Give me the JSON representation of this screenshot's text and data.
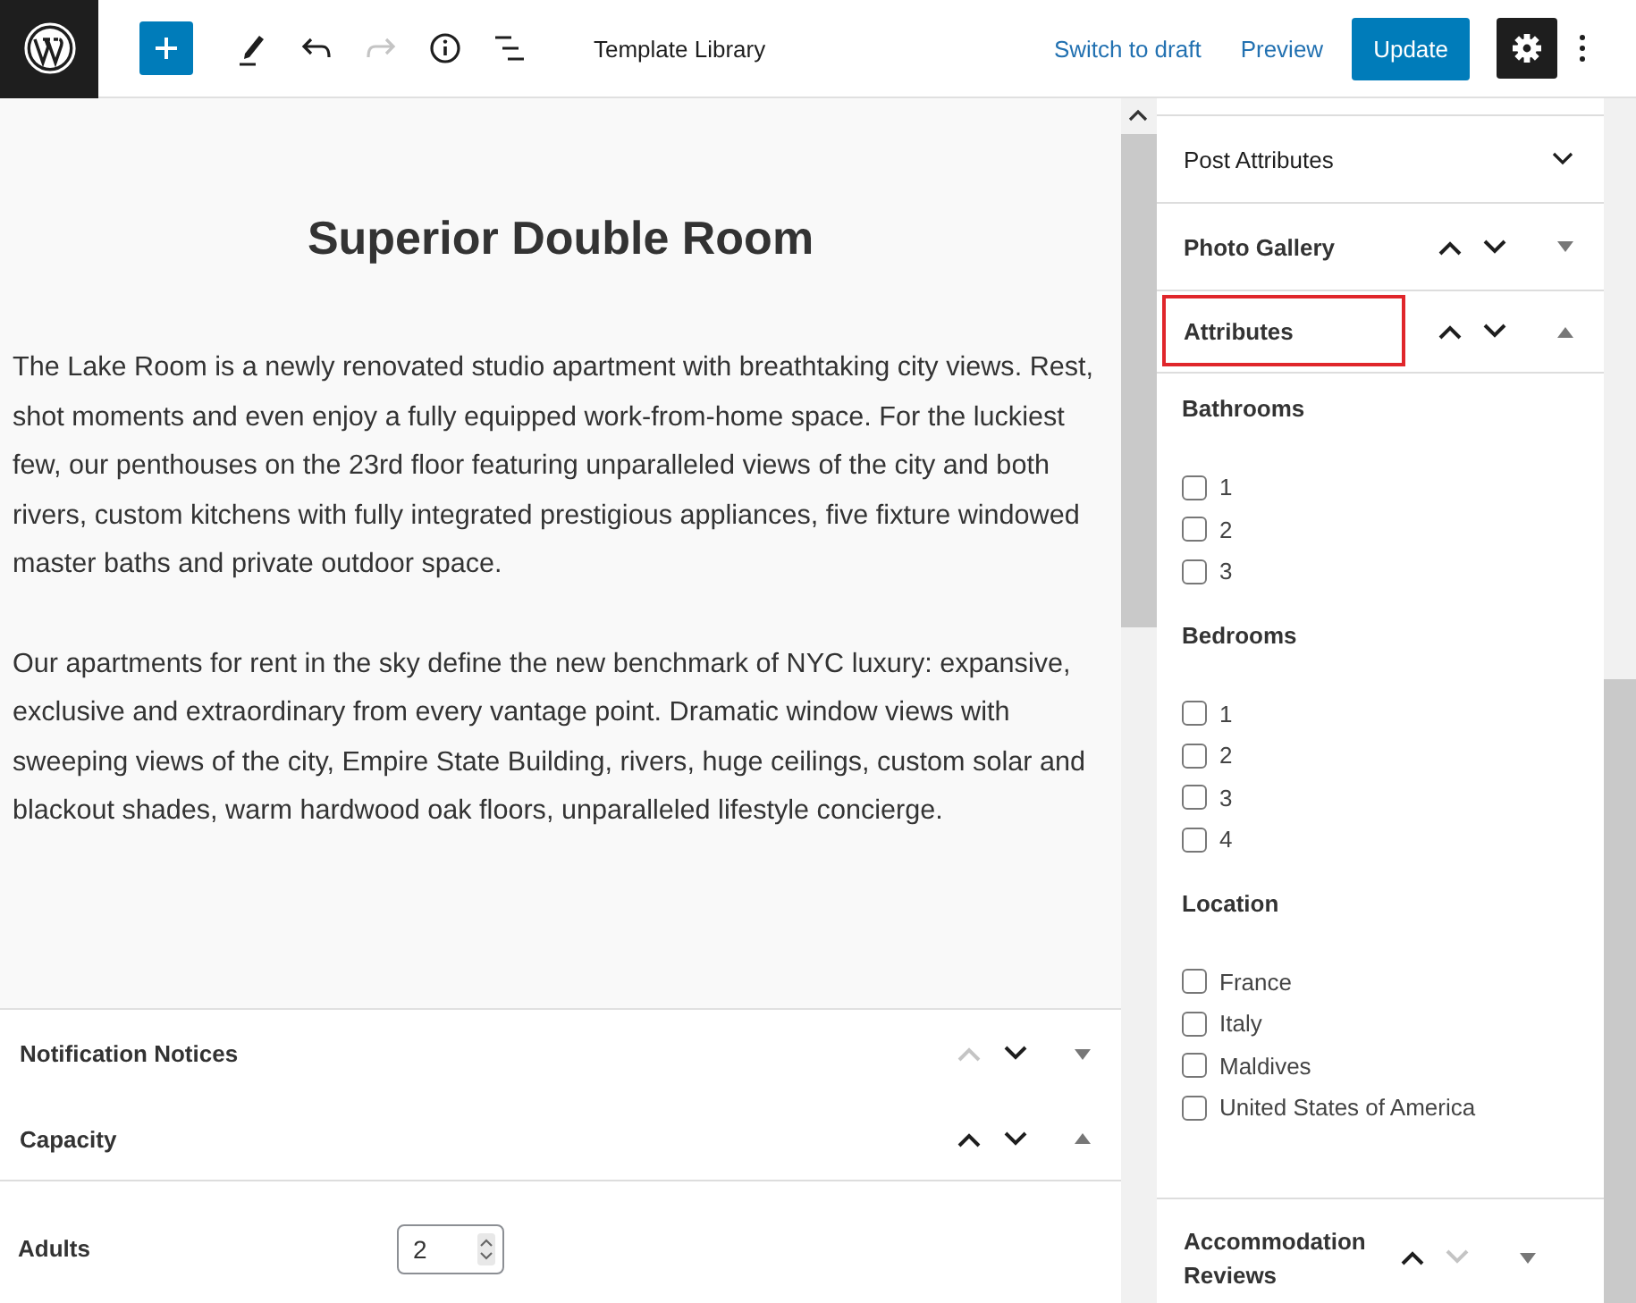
{
  "toolbar": {
    "title": "Template Library",
    "redo_disabled": true,
    "links": [
      "Switch to draft",
      "Preview"
    ],
    "primary_button": "Update",
    "settings_active": true
  },
  "post": {
    "title": "Superior Double Room",
    "paragraphs": [
      "The Lake Room is a newly renovated studio apartment with breathtaking city views. Rest, shot moments and even enjoy a fully equipped work-from-home space. For the luckiest few, our penthouses on the 23rd floor featuring unparalleled views of the city and both rivers, custom kitchens with fully integrated prestigious appliances, five fixture windowed master baths and private outdoor space.",
      "Our apartments for rent in the sky define the new benchmark of NYC luxury: expansive, exclusive and extraordinary from every vantage point. Dramatic window views with sweeping views of the city, Empire State Building, rivers, huge ceilings, custom solar and blackout shades, warm hardwood oak floors, unparalleled lifestyle concierge."
    ]
  },
  "meta_boxes": [
    {
      "title": "Notification Notices",
      "can_move_up": false,
      "can_move_down": true,
      "expanded": false
    },
    {
      "title": "Capacity",
      "can_move_up": true,
      "can_move_down": true,
      "expanded": true,
      "fields": [
        {
          "label": "Adults",
          "value": "2"
        }
      ]
    }
  ],
  "sidebar": {
    "panels": [
      {
        "kind": "simple",
        "title": "Post Attributes",
        "expanded": false
      },
      {
        "kind": "movable",
        "title": "Photo Gallery",
        "can_move_up": true,
        "can_move_down": true,
        "expanded": false,
        "highlighted": false
      },
      {
        "kind": "movable",
        "title": "Attributes",
        "can_move_up": true,
        "can_move_down": true,
        "expanded": true,
        "highlighted": true,
        "groups": [
          {
            "title": "Bathrooms",
            "options": [
              {
                "label": "1",
                "checked": false
              },
              {
                "label": "2",
                "checked": false
              },
              {
                "label": "3",
                "checked": false
              }
            ]
          },
          {
            "title": "Bedrooms",
            "options": [
              {
                "label": "1",
                "checked": false
              },
              {
                "label": "2",
                "checked": false
              },
              {
                "label": "3",
                "checked": false
              },
              {
                "label": "4",
                "checked": false
              }
            ]
          },
          {
            "title": "Location",
            "options": [
              {
                "label": "France",
                "checked": false
              },
              {
                "label": "Italy",
                "checked": false
              },
              {
                "label": "Maldives",
                "checked": false
              },
              {
                "label": "United States of America",
                "checked": false
              }
            ]
          }
        ]
      },
      {
        "kind": "movable",
        "title": "Accommodation Reviews",
        "can_move_up": true,
        "can_move_down": false,
        "expanded": false,
        "highlighted": false
      }
    ]
  }
}
